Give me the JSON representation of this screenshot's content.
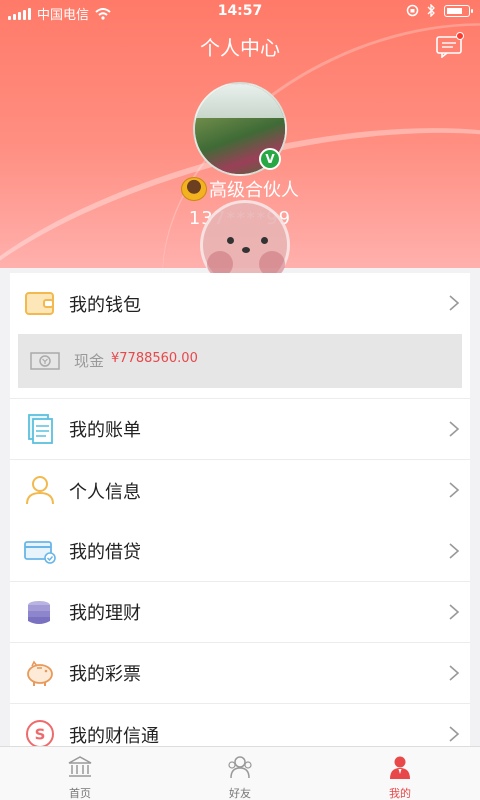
{
  "status_bar": {
    "carrier": "中国电信",
    "time": "14:57"
  },
  "header": {
    "title": "个人中心",
    "user_level": "高级合伙人",
    "phone": "137****99",
    "verified_badge": "V"
  },
  "wallet": {
    "title": "我的钱包",
    "cash_label": "现金",
    "cash_amount": "¥7788560.00"
  },
  "menu_group_1": [
    {
      "label": "我的账单",
      "icon": "bill-icon"
    },
    {
      "label": "个人信息",
      "icon": "person-icon"
    }
  ],
  "menu_group_2": [
    {
      "label": "我的借贷",
      "icon": "card-icon"
    },
    {
      "label": "我的理财",
      "icon": "coins-icon"
    },
    {
      "label": "我的彩票",
      "icon": "piggy-icon"
    },
    {
      "label": "我的财信通",
      "icon": "s-coin-icon"
    }
  ],
  "tabbar": {
    "items": [
      {
        "label": "首页",
        "icon": "bank-icon"
      },
      {
        "label": "好友",
        "icon": "friends-icon"
      },
      {
        "label": "我的",
        "icon": "me-icon"
      }
    ],
    "active_index": 2
  },
  "colors": {
    "accent": "#e8484a",
    "header_top": "#ff7a68",
    "header_bottom": "#ffb0ad"
  }
}
